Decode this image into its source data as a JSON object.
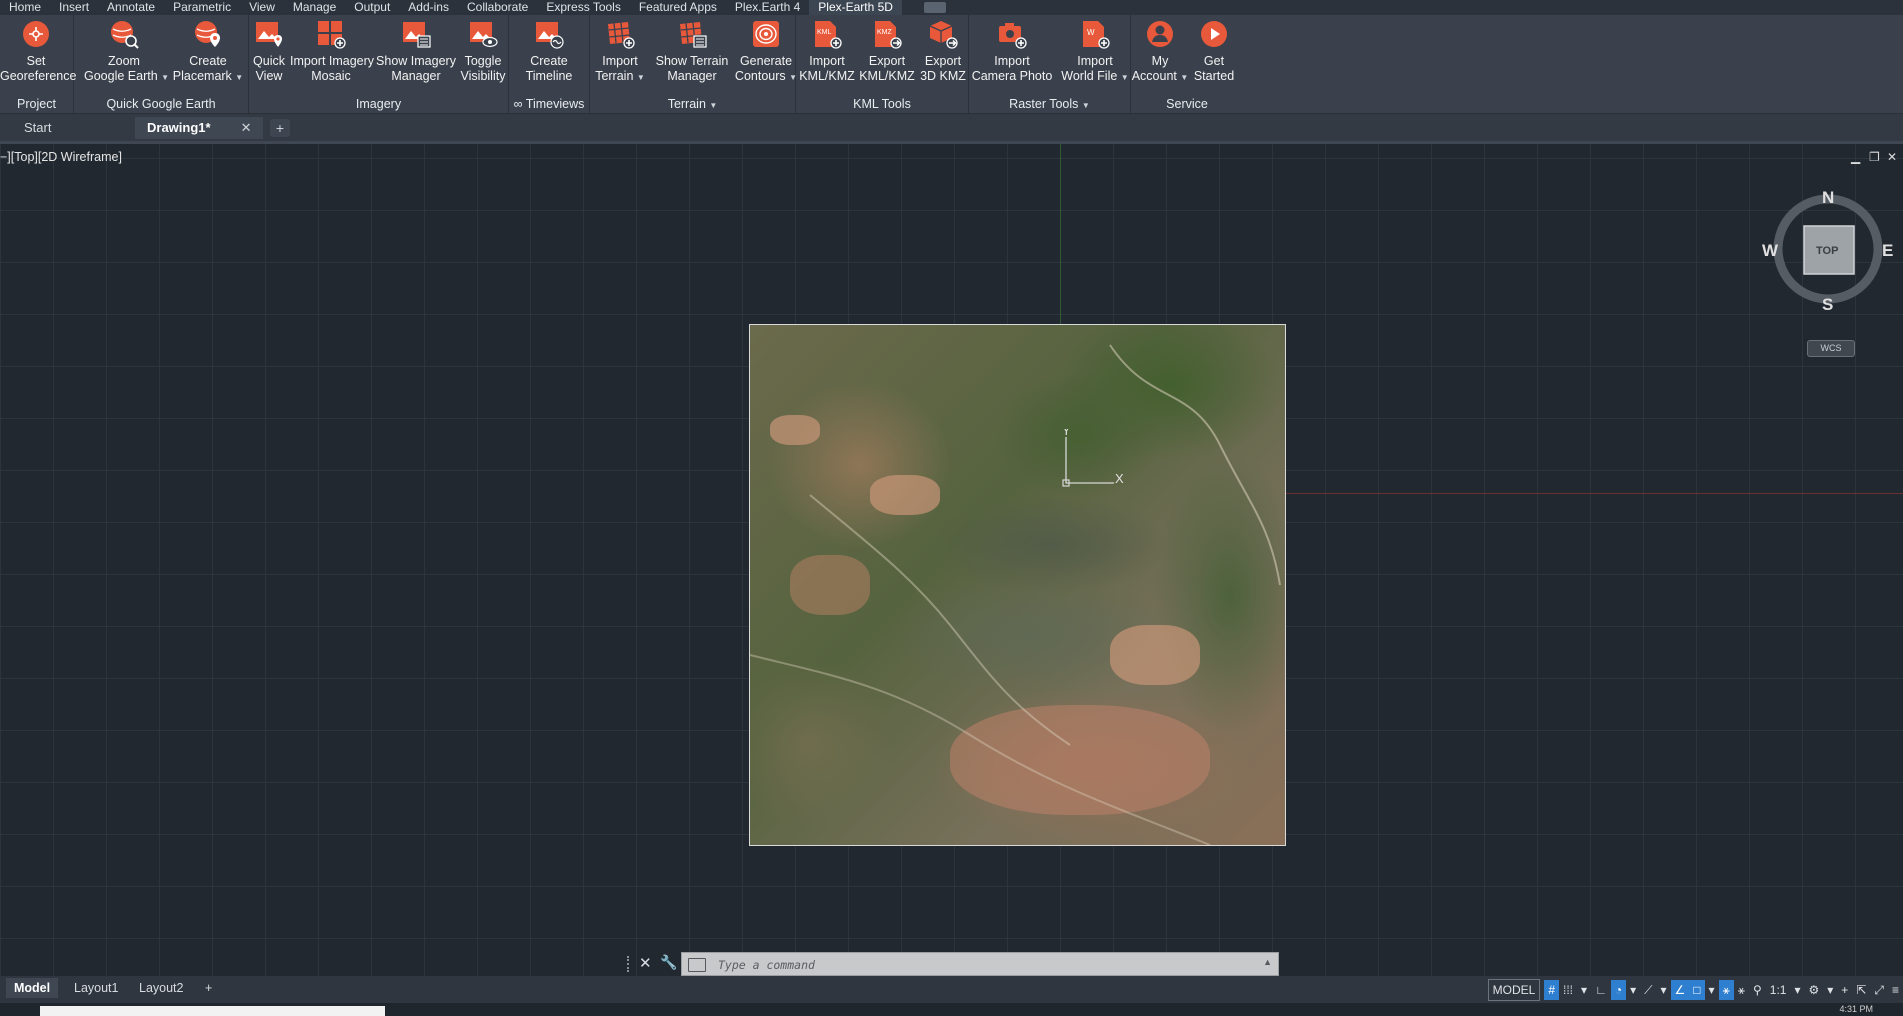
{
  "menu_tabs": [
    "Home",
    "Insert",
    "Annotate",
    "Parametric",
    "View",
    "Manage",
    "Output",
    "Add-ins",
    "Collaborate",
    "Express Tools",
    "Featured Apps",
    "Plex.Earth 4",
    "Plex-Earth 5D"
  ],
  "ribbon": {
    "panels": {
      "project": "Project",
      "quick_google_earth": "Quick Google Earth",
      "imagery": "Imagery",
      "timeviews": "∞ Timeviews",
      "terrain": "Terrain",
      "kml_tools": "KML Tools",
      "raster_tools": "Raster Tools",
      "service": "Service"
    },
    "tools": {
      "set_georeference": [
        "Set",
        "Georeference"
      ],
      "zoom_google_earth": [
        "Zoom",
        "Google Earth"
      ],
      "create_placemark": [
        "Create",
        "Placemark"
      ],
      "quick_view": [
        "Quick",
        "View"
      ],
      "import_imagery_mosaic": [
        "Import Imagery",
        "Mosaic"
      ],
      "show_imagery_manager": [
        "Show Imagery",
        "Manager"
      ],
      "toggle_visibility": [
        "Toggle",
        "Visibility"
      ],
      "create_timeline": [
        "Create",
        "Timeline"
      ],
      "import_terrain": [
        "Import",
        "Terrain"
      ],
      "show_terrain_manager": [
        "Show Terrain",
        "Manager"
      ],
      "generate_contours": [
        "Generate",
        "Contours"
      ],
      "import_kml": [
        "Import",
        "KML/KMZ"
      ],
      "export_kml": [
        "Export",
        "KML/KMZ"
      ],
      "export_3d_kmz": [
        "Export",
        "3D KMZ"
      ],
      "import_camera_photo": [
        "Import",
        "Camera Photo"
      ],
      "import_world_file": [
        "Import",
        "World File"
      ],
      "my_account": [
        "My",
        "Account"
      ],
      "get_started": [
        "Get",
        "Started"
      ]
    },
    "icon_glyphs": {
      "kml": "KML",
      "kmz": "KMZ",
      "world_file": "W"
    }
  },
  "file_tabs": {
    "start": "Start",
    "drawing": "Drawing1*",
    "close": "✕",
    "add": "+"
  },
  "viewport": {
    "label": "−][Top][2D Wireframe]",
    "window_controls": [
      "▁",
      "❐",
      "✕"
    ],
    "viewcube": {
      "n": "N",
      "s": "S",
      "e": "E",
      "w": "W",
      "face": "TOP"
    },
    "wcs": "WCS",
    "ucs": {
      "x": "X",
      "y": "Y"
    }
  },
  "command": {
    "placeholder": "Type a command",
    "close": "✕",
    "wrench": "🔧",
    "expand": "▲"
  },
  "layout_tabs": [
    "Model",
    "Layout1",
    "Layout2"
  ],
  "layout_add": "+",
  "status": {
    "model": "MODEL",
    "scale": "1:1"
  },
  "taskbar": {
    "clock": "4:31 PM"
  },
  "colors": {
    "accent_orange": "#e8583a",
    "ribbon_bg": "#3a414c",
    "canvas_bg": "#212830"
  }
}
